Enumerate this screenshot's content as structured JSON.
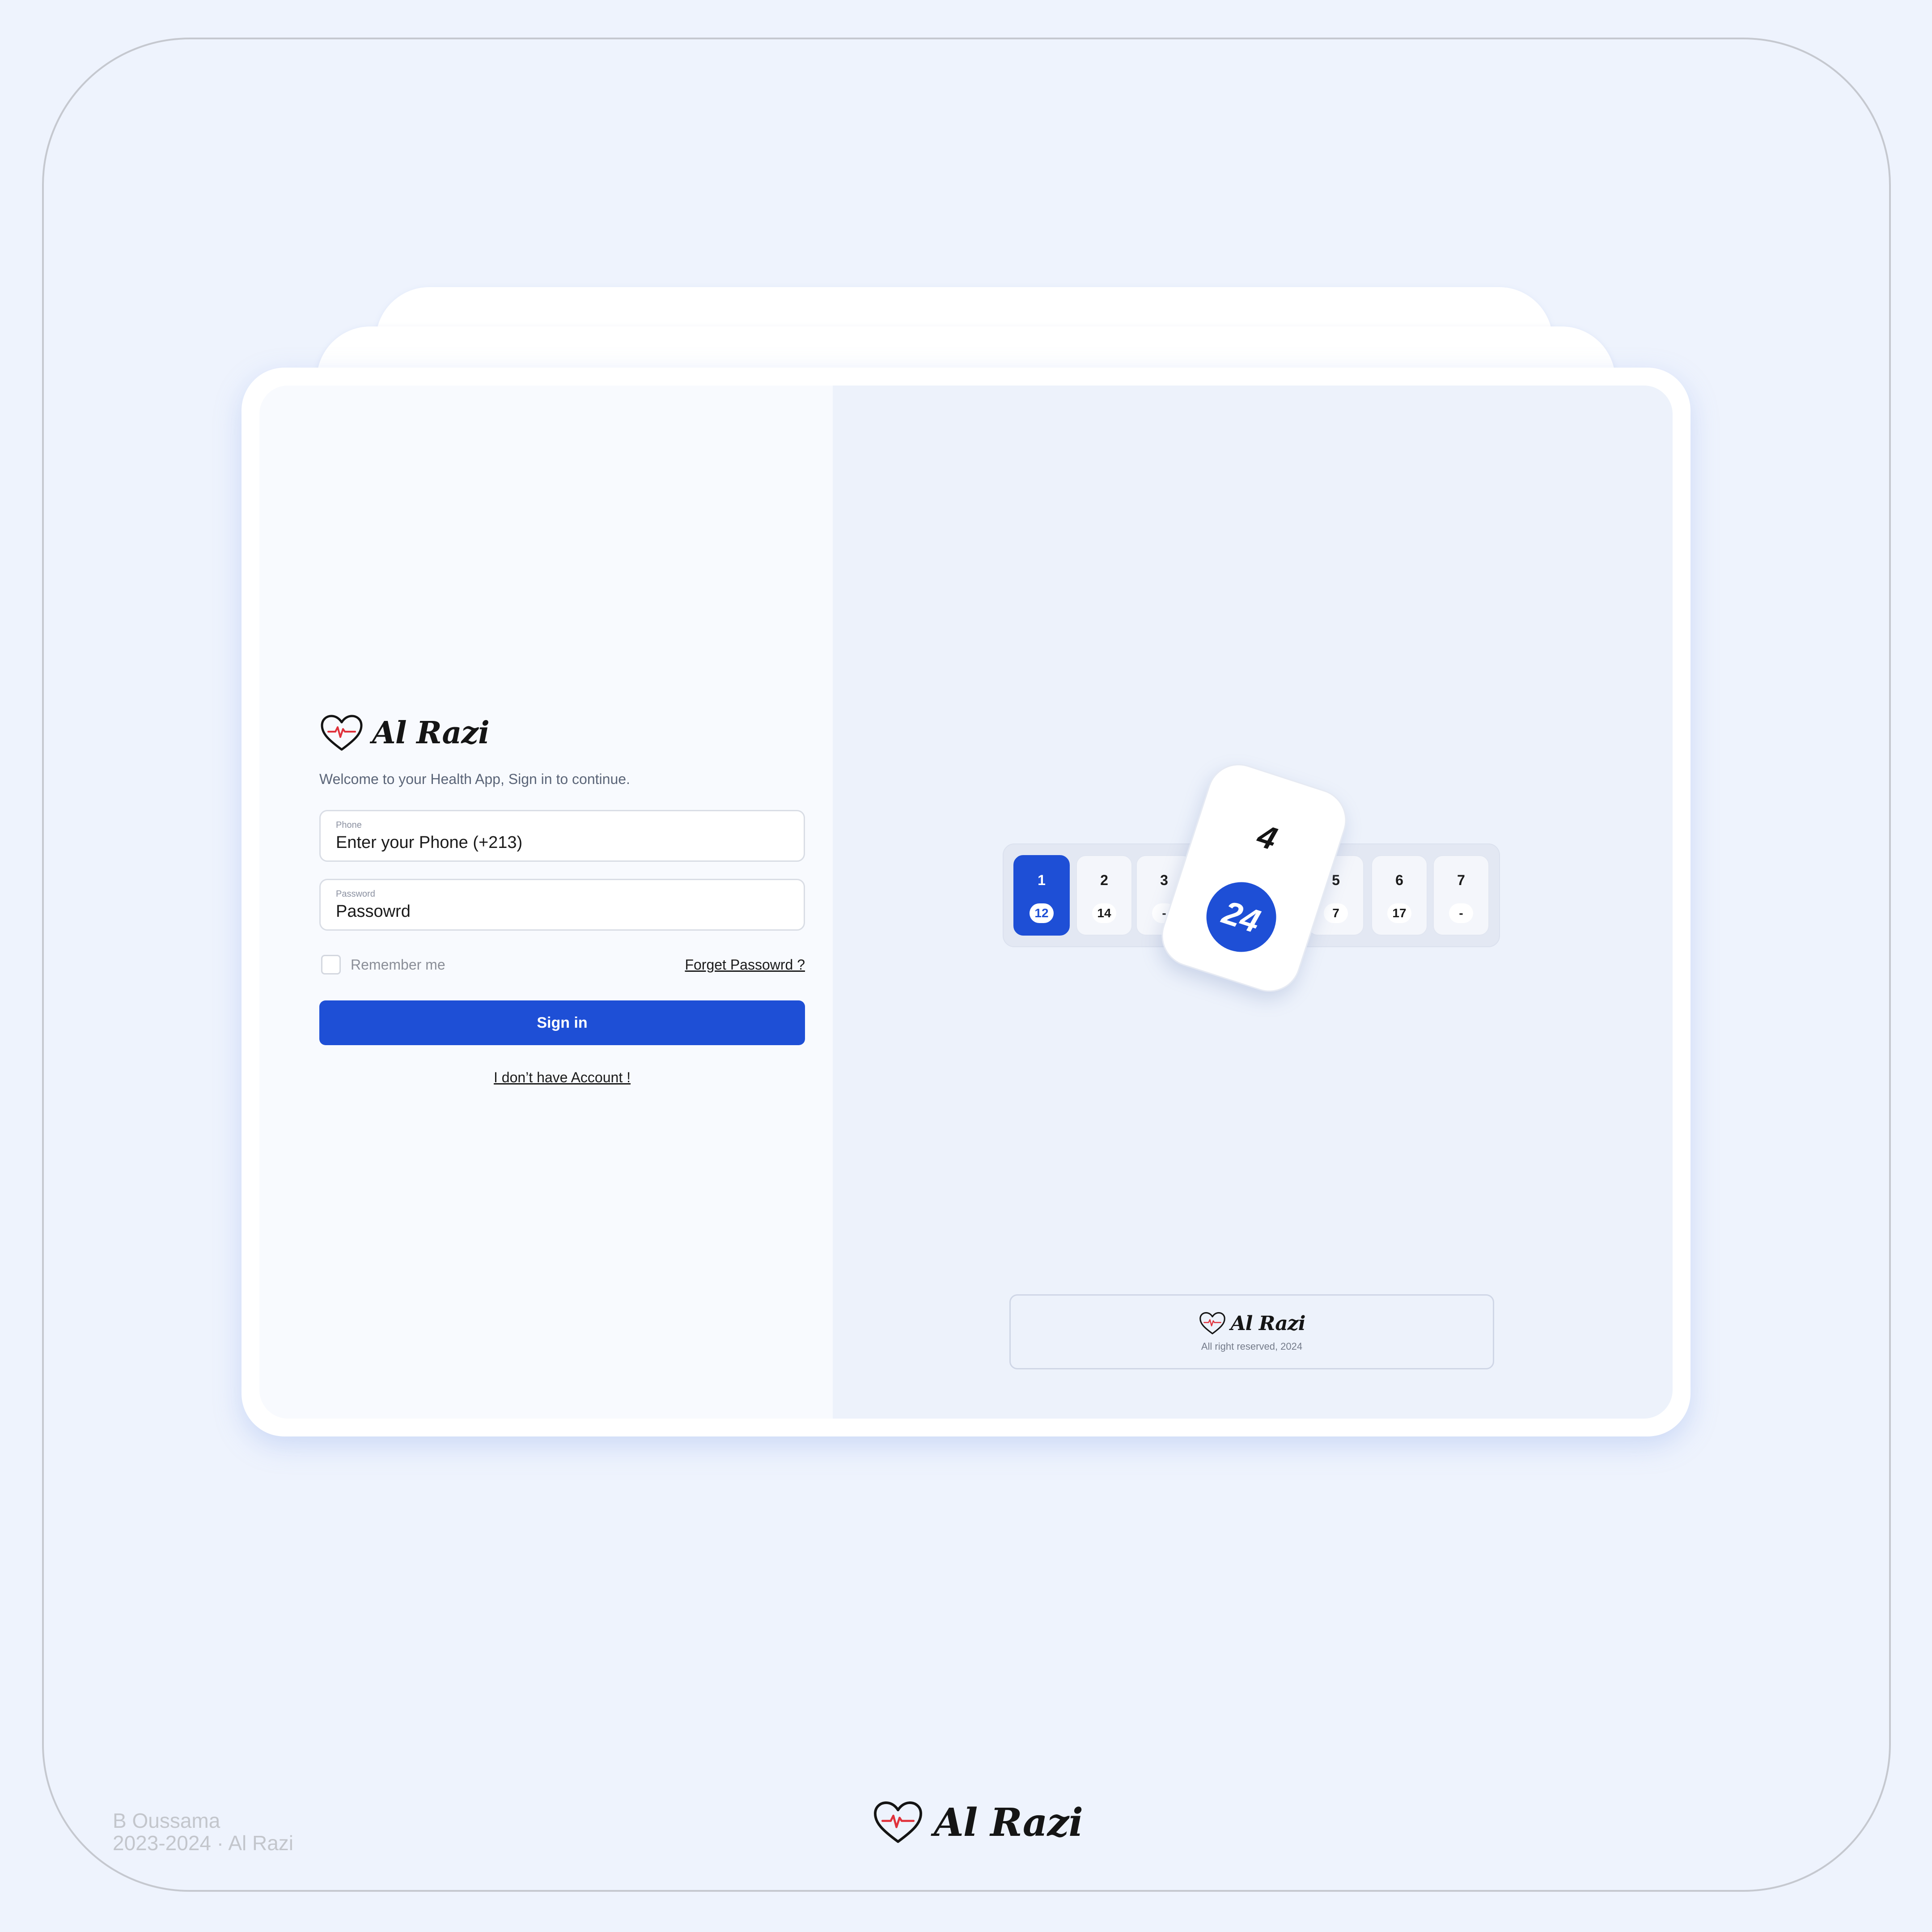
{
  "brand": {
    "name": "Al Razi"
  },
  "login": {
    "welcome": "Welcome to your Health App, Sign in to continue.",
    "phone": {
      "label": "Phone",
      "value": "Enter your Phone (+213)"
    },
    "password": {
      "label": "Password",
      "value": "Passowrd"
    },
    "remember_label": "Remember me",
    "forget_label": "Forget Passowrd ?",
    "signin_label": "Sign in",
    "no_account_label": "I don’t have Account !"
  },
  "calendar": {
    "days": [
      {
        "day": "1",
        "count": "12",
        "active": true
      },
      {
        "day": "2",
        "count": "14"
      },
      {
        "day": "3",
        "count": "-"
      },
      {
        "day": "4",
        "count": "24"
      },
      {
        "day": "5",
        "count": "7"
      },
      {
        "day": "6",
        "count": "17"
      },
      {
        "day": "7",
        "count": "-"
      }
    ],
    "selected": {
      "day": "4",
      "count": "24"
    }
  },
  "footer": {
    "rights": "All right reserved, 2024"
  },
  "credit": {
    "author": "B Oussama",
    "line2": "2023-2024 · Al Razi"
  },
  "colors": {
    "accent": "#1e4fd6",
    "background": "#eef3fd",
    "heart_line": "#e0323c"
  }
}
